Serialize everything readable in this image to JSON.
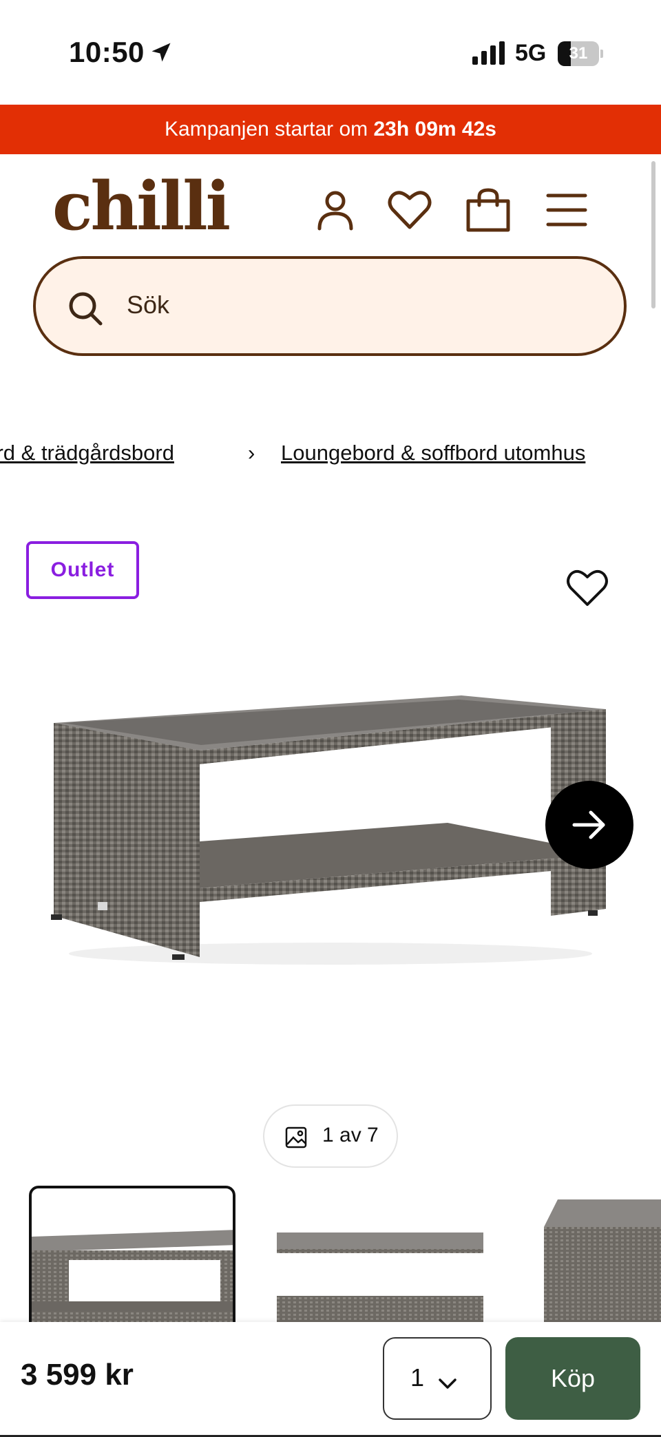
{
  "status_bar": {
    "time": "10:50",
    "network": "5G",
    "battery": "31",
    "battery_level": 0.31
  },
  "promo": {
    "prefix": "Kampanjen startar om ",
    "countdown": "23h 09m 42s"
  },
  "header": {
    "logo": "chilli"
  },
  "search": {
    "placeholder": "Sök"
  },
  "breadcrumb": {
    "items": [
      "bord & trädgårdsbord",
      "Loungebord & soffbord utomhus"
    ],
    "separator": "›"
  },
  "product": {
    "badge": "Outlet",
    "image_counter": "1 av 7",
    "price": "3 599 kr"
  },
  "buybar": {
    "quantity": "1",
    "buy_label": "Köp"
  },
  "colors": {
    "promo_bg": "#e22f05",
    "brand": "#5a2f10",
    "search_bg": "#fff2e8",
    "badge": "#8a1ee0",
    "buy_bg": "#3e5e44"
  }
}
